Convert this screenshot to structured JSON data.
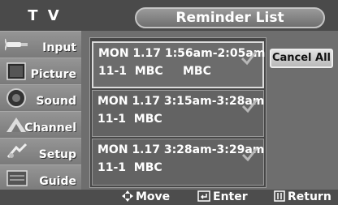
{
  "header": {
    "app_title": "T V",
    "screen_title": "Reminder List"
  },
  "sidebar": {
    "items": [
      {
        "label": "Input",
        "icon": "input-icon"
      },
      {
        "label": "Picture",
        "icon": "picture-icon"
      },
      {
        "label": "Sound",
        "icon": "sound-icon"
      },
      {
        "label": "Channel",
        "icon": "channel-icon"
      },
      {
        "label": "Setup",
        "icon": "setup-icon"
      },
      {
        "label": "Guide",
        "icon": "guide-icon"
      }
    ]
  },
  "reminders": [
    {
      "datetime": "MON 1.17 1:56am-2:05am",
      "channel": "11-1",
      "network": "MBC",
      "program": "MBC",
      "checked": true,
      "selected": true
    },
    {
      "datetime": "MON 1.17 3:15am-3:28am",
      "channel": "11-1",
      "network": "MBC",
      "program": "",
      "checked": true,
      "selected": false
    },
    {
      "datetime": "MON 1.17 3:28am-3:29am",
      "channel": "11-1",
      "network": "MBC",
      "program": "",
      "checked": true,
      "selected": false
    }
  ],
  "actions": {
    "cancel_all_label": "Cancel All"
  },
  "footer": {
    "move_label": "Move",
    "enter_label": "Enter",
    "return_label": "Return"
  },
  "colors": {
    "background": "#6e6e6e",
    "header": "#4a4a4a",
    "list_bg": "#474747",
    "text": "#ffffff",
    "check": "#b8b8b8"
  }
}
